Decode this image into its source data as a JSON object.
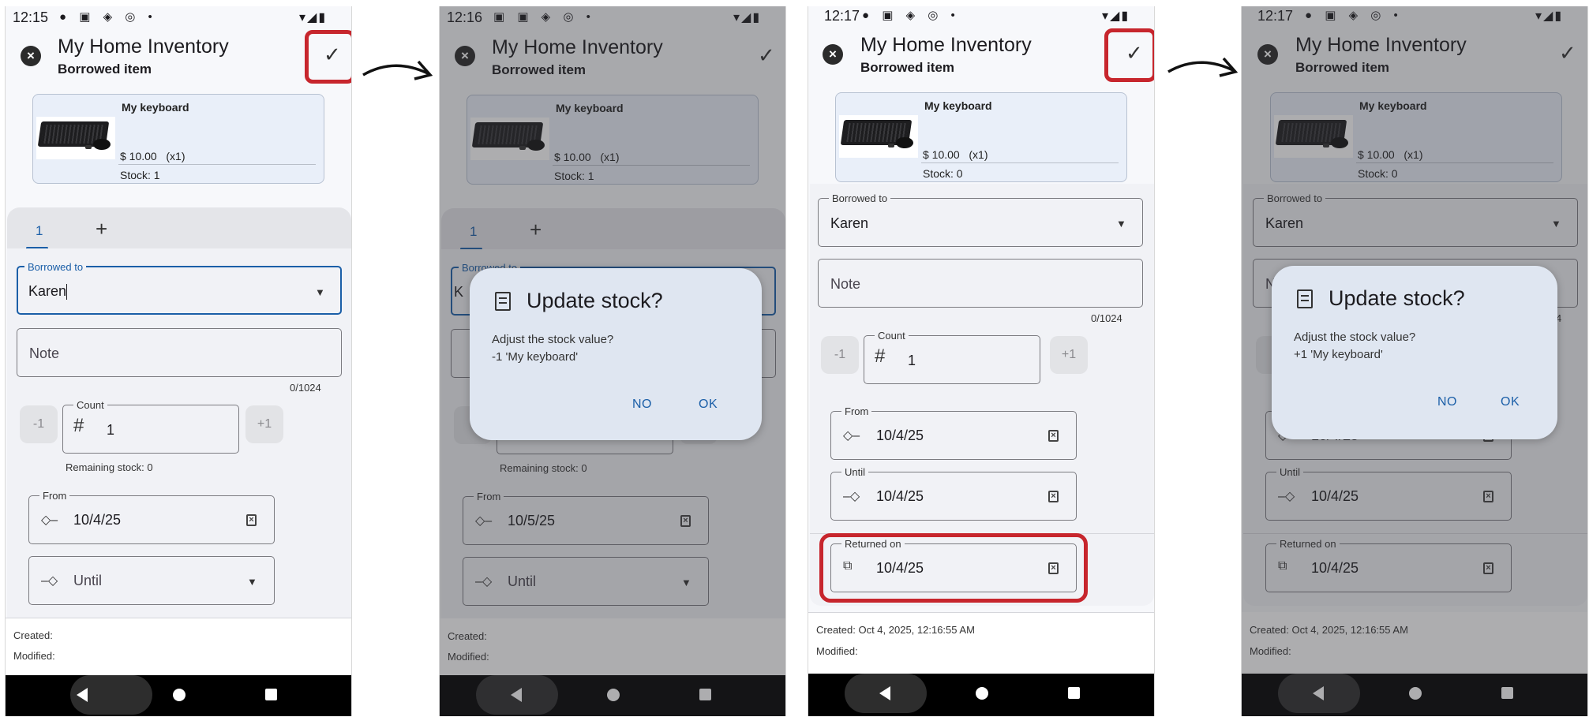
{
  "app": {
    "title": "My Home Inventory",
    "subtitle": "Borrowed item"
  },
  "item": {
    "name": "My keyboard",
    "price": "$ 10.00",
    "qty": "(x1)"
  },
  "labels": {
    "tab_1": "1",
    "borrowed_to": "Borrowed to",
    "note": "Note",
    "note_counter": "0/1024",
    "count": "Count",
    "count_dec": "-1",
    "count_inc": "+1",
    "from": "From",
    "until": "Until",
    "returned_on": "Returned on",
    "created": "Created:",
    "modified": "Modified:"
  },
  "screens": [
    {
      "time": "12:15",
      "stock": "Stock: 1",
      "borrower": "Karen",
      "count": "1",
      "remaining": "Remaining stock: 0",
      "from_date": "10/4/25",
      "created": "Created:",
      "modified": "Modified:"
    },
    {
      "time": "12:16",
      "stock": "Stock: 1",
      "borrower": "K",
      "remaining": "Remaining stock: 0",
      "from_date": "10/5/25",
      "created": "Created:",
      "modified": "Modified:",
      "dialog": {
        "title": "Update stock?",
        "line1": "Adjust the stock value?",
        "line2": "-1 'My keyboard'",
        "no": "NO",
        "ok": "OK"
      }
    },
    {
      "time": "12:17",
      "stock": "Stock: 0",
      "borrower": "Karen",
      "count": "1",
      "from_date": "10/4/25",
      "until_date": "10/4/25",
      "returned_date": "10/4/25",
      "created": "Created: Oct 4, 2025, 12:16:55 AM",
      "modified": "Modified:"
    },
    {
      "time": "12:17",
      "stock": "Stock: 0",
      "borrower": "Karen",
      "note_initial": "N",
      "counter_tail": "4",
      "from_date": "10/4/25",
      "until_date": "10/4/25",
      "returned_date": "10/4/25",
      "created": "Created: Oct 4, 2025, 12:16:55 AM",
      "modified": "Modified:",
      "dialog": {
        "title": "Update stock?",
        "line1": "Adjust the stock value?",
        "line2": "+1 'My keyboard'",
        "no": "NO",
        "ok": "OK"
      }
    }
  ],
  "icons": {
    "close": "close-circle-icon",
    "save": "check-icon",
    "dropdown": "caret-down-icon",
    "count": "hash-icon",
    "from": "diamond-left-icon",
    "until": "diamond-right-icon",
    "returned": "return-box-icon",
    "clear": "clear-date-icon",
    "dialog": "inventory-icon"
  },
  "colors": {
    "accent": "#1b5fa8",
    "highlight": "#c7262d"
  }
}
